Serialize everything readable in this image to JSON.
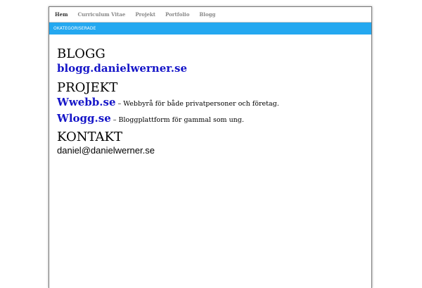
{
  "nav": {
    "items": [
      {
        "label": "Hem",
        "active": true
      },
      {
        "label": "Curriculum Vitae",
        "active": false
      },
      {
        "label": "Projekt",
        "active": false
      },
      {
        "label": "Portfolio",
        "active": false
      },
      {
        "label": "Blogg",
        "active": false
      }
    ]
  },
  "subbar": {
    "label": "OKATEGORISERADE",
    "color": "#24a8f0"
  },
  "sections": {
    "blogg": {
      "heading": "BLOGG",
      "link": "blogg.danielwerner.se"
    },
    "projekt": {
      "heading": "PROJEKT",
      "items": [
        {
          "link": "Wwebb.se",
          "description": " – Webbyrå för både privatpersoner och företag."
        },
        {
          "link": "Wlogg.se",
          "description": " – Bloggplattform för gammal som ung."
        }
      ]
    },
    "kontakt": {
      "heading": "KONTAKT",
      "email": "daniel@danielwerner.se"
    }
  },
  "colors": {
    "link": "#1515c8",
    "accent": "#24a8f0"
  }
}
